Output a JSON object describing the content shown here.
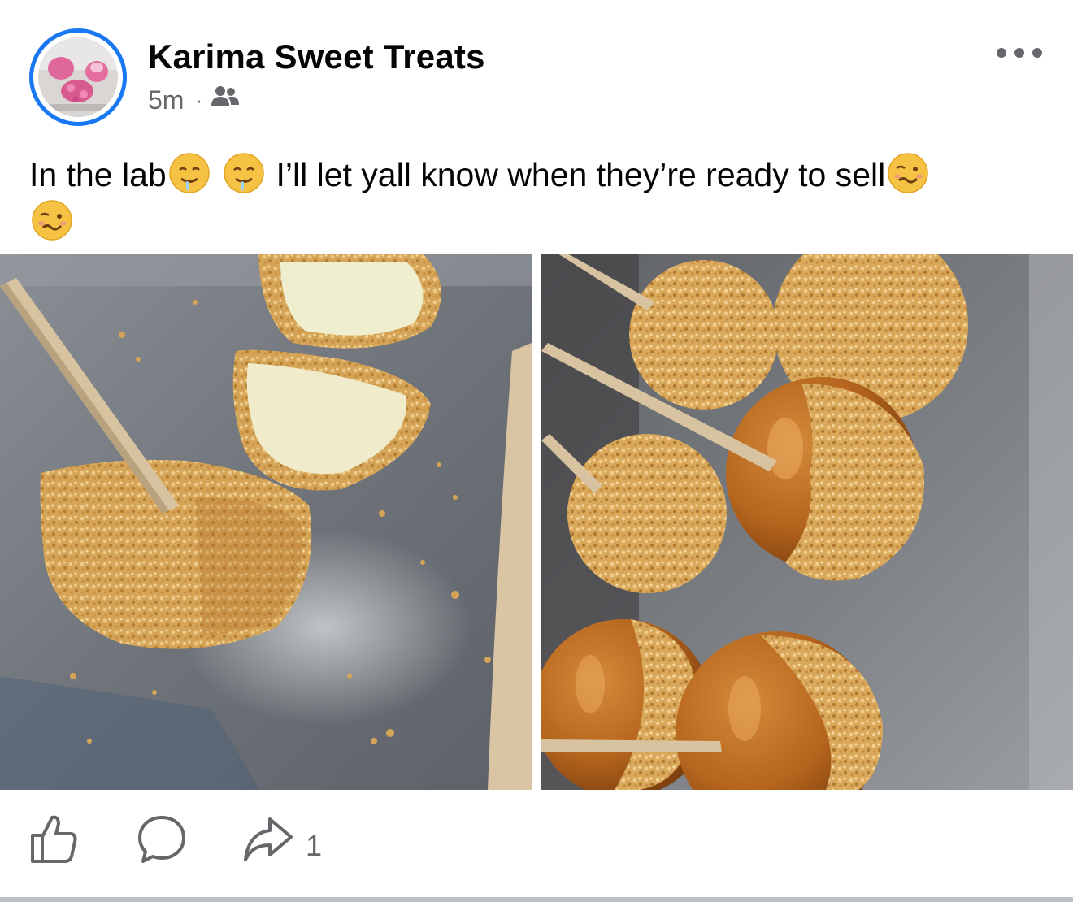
{
  "post": {
    "page_name": "Karima Sweet Treats",
    "time": "5m",
    "separator": "·",
    "audience_icon": "friends-icon",
    "more_icon": "more-dots-icon",
    "caption": {
      "part1": "In the lab",
      "part2": "I’ll let yall know when they’re ready to sell"
    },
    "emojis": [
      "drooling-face",
      "drooling-face",
      "woozy-face",
      "woozy-face"
    ],
    "photos": [
      {
        "description_icon": "caramel-apple-slices-photo"
      },
      {
        "description_icon": "caramel-apples-tray-photo"
      }
    ]
  },
  "actions": {
    "like_icon": "like-icon",
    "comment_icon": "comment-icon",
    "share_icon": "share-icon",
    "share_count": "1"
  },
  "colors": {
    "accent": "#1877f2",
    "secondary_text": "#65676b",
    "caramel": "#b8651c",
    "nuts": "#d9a85a",
    "tray": "#7a7f86"
  }
}
